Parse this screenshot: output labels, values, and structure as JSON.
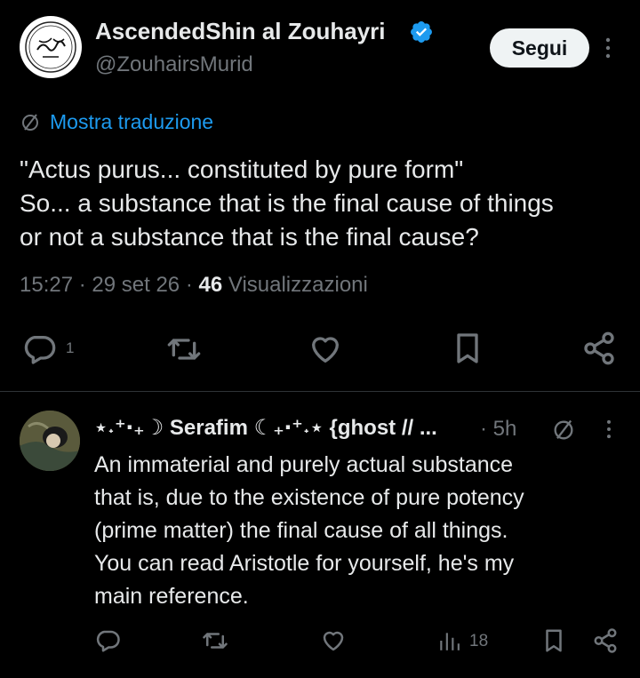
{
  "post": {
    "author_name": "AscendedShin al Zouhayri",
    "handle": "@ZouhairsMurid",
    "follow_label": "Segui",
    "translate_label": "Mostra traduzione",
    "lines": [
      "\"Actus purus... constituted by pure form\"",
      "So... a substance that is the final cause of things",
      "or not a substance that is the final cause?"
    ],
    "time": "15:27",
    "date": "29 set 26",
    "views_count": "46",
    "views_label": "Visualizzazioni",
    "reply_count": "1"
  },
  "reply": {
    "author_name": "⋆˖⁺‧₊☽ Serafim ☾₊‧⁺˖⋆ {ghost // ...",
    "time": "· 5h",
    "lines": [
      "An immaterial and purely actual substance",
      "that is, due to the existence of pure potency",
      "(prime matter) the final cause of all things.",
      "You can read Aristotle for yourself, he's my",
      "main reference."
    ],
    "views_count": "18"
  },
  "icons": {
    "verified": "verified-badge-icon",
    "more": "more-icon",
    "translate": "translate-icon",
    "reply": "reply-icon",
    "retweet": "retweet-icon",
    "like": "like-icon",
    "bookmark": "bookmark-icon",
    "share": "share-icon",
    "views": "views-icon"
  },
  "colors": {
    "background": "#000000",
    "text": "#e7e9ea",
    "muted": "#71767b",
    "accent": "#1d9bf0"
  }
}
